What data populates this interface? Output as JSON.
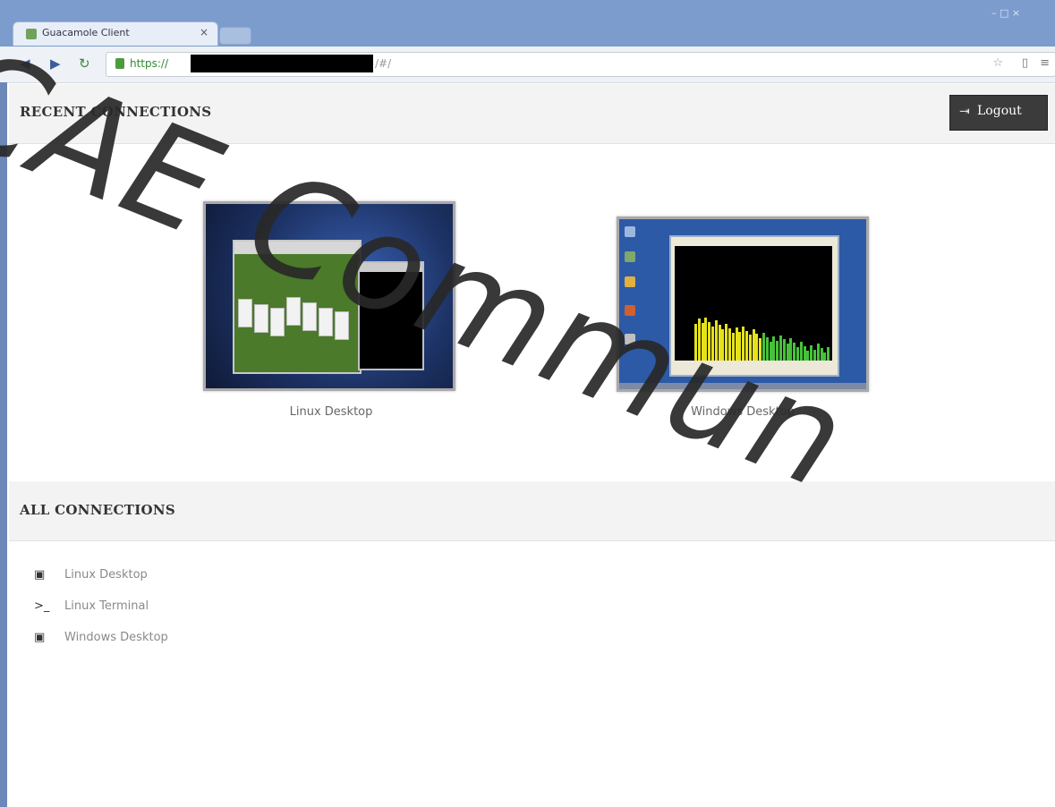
{
  "browser": {
    "tab_title": "Guacamole Client",
    "tab_close": "×",
    "window_controls": "– □ ×",
    "url_scheme": "https://",
    "url_tail": "/#/"
  },
  "header": {
    "recent_title": "RECENT CONNECTIONS",
    "logout_label": "Logout"
  },
  "recent": [
    {
      "name": "Linux Desktop"
    },
    {
      "name": "Windows Desktop"
    }
  ],
  "all": {
    "title": "ALL CONNECTIONS",
    "items": [
      {
        "label": "Linux Desktop",
        "icon": "desktop-icon"
      },
      {
        "label": "Linux Terminal",
        "icon": "terminal-icon"
      },
      {
        "label": "Windows Desktop",
        "icon": "desktop-icon"
      }
    ]
  },
  "watermark": "CAE Commun",
  "colors": {
    "titlebar": "#7b9ccd",
    "logout_bg": "#3b3b3b",
    "section_bg": "#f3f3f3"
  }
}
